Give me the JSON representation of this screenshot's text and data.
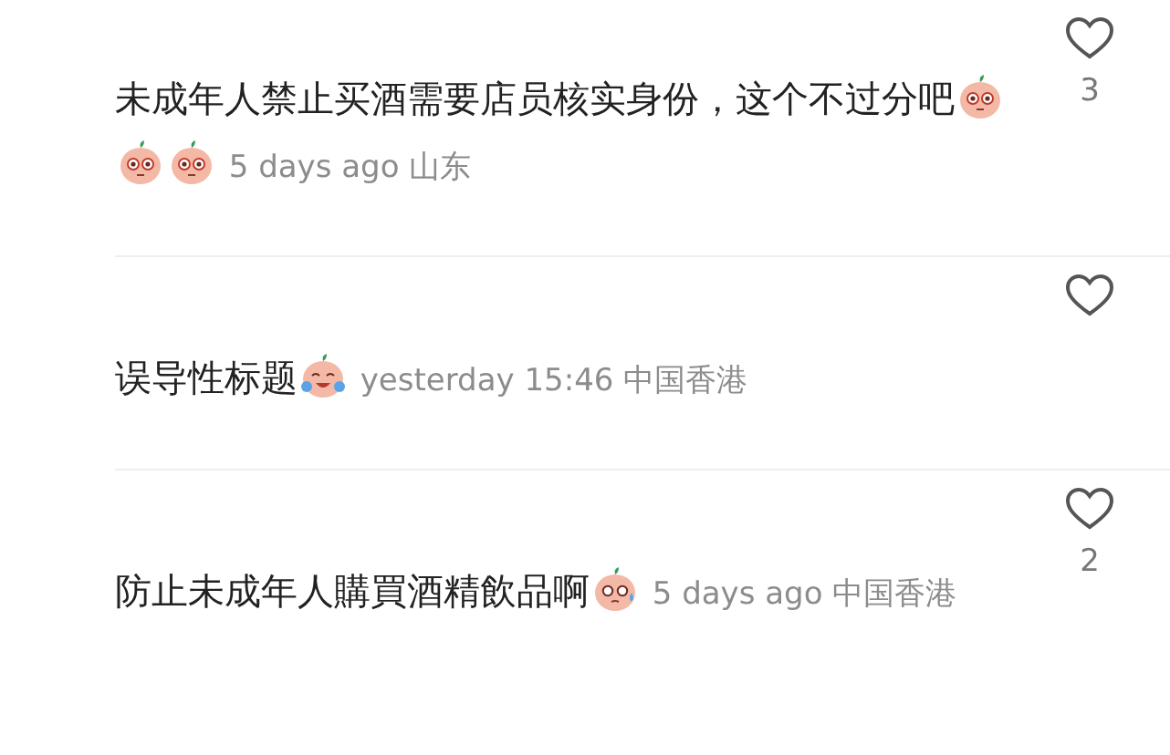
{
  "comments": [
    {
      "text": "未成年人禁止买酒需要店员核实身份，这个不过分吧",
      "emojis": [
        {
          "kind": "big-eyes"
        },
        {
          "kind": "big-eyes"
        },
        {
          "kind": "big-eyes"
        }
      ],
      "time": "5 days ago",
      "location": "山东",
      "liked": false,
      "like_count": "3"
    },
    {
      "text": "误导性标题",
      "emojis": [
        {
          "kind": "tears-of-joy"
        }
      ],
      "time": "yesterday 15:46",
      "location": "中国香港",
      "liked": false
    },
    {
      "text": "防止未成年人購買酒精飲品啊",
      "emojis": [
        {
          "kind": "nervous-sweat"
        }
      ],
      "time": "5 days ago",
      "location": "中国香港",
      "liked": false,
      "like_count": "2"
    }
  ]
}
